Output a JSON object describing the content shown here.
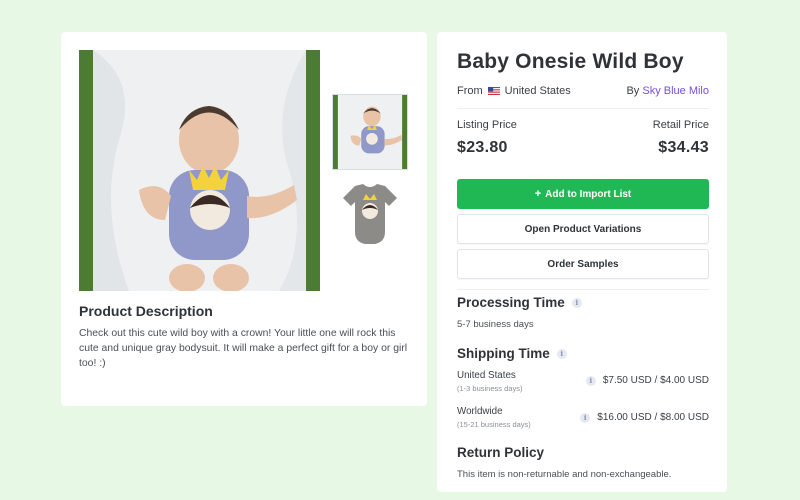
{
  "product": {
    "title": "Baby Onesie Wild Boy",
    "origin_prefix": "From",
    "origin_country": "United States",
    "seller_prefix": "By",
    "seller_name": "Sky Blue Milo"
  },
  "pricing": {
    "listing_label": "Listing Price",
    "listing_value": "$23.80",
    "retail_label": "Retail Price",
    "retail_value": "$34.43"
  },
  "actions": {
    "add_label": "Add to Import List",
    "add_icon": "+",
    "variations_label": "Open Product Variations",
    "samples_label": "Order Samples"
  },
  "description": {
    "title": "Product Description",
    "text": "Check out this cute wild boy with a crown! Your little one will rock this cute and unique gray bodysuit. It will make a perfect gift for a boy or girl too! :)"
  },
  "processing": {
    "title": "Processing Time",
    "value": "5-7 business days"
  },
  "shipping": {
    "title": "Shipping Time",
    "rows": [
      {
        "region": "United States",
        "days": "(1-3 business days)",
        "price": "$7.50 USD / $4.00 USD"
      },
      {
        "region": "Worldwide",
        "days": "(15-21 business days)",
        "price": "$16.00 USD / $8.00 USD"
      }
    ]
  },
  "returns": {
    "title": "Return Policy",
    "text": "This item is non-returnable and non-exchangeable."
  },
  "icons": {
    "info": "i",
    "flag": "us-flag-icon"
  },
  "colors": {
    "background": "#e7f9e4",
    "primary_button": "#1fb854",
    "seller_link": "#7a4fd6"
  }
}
